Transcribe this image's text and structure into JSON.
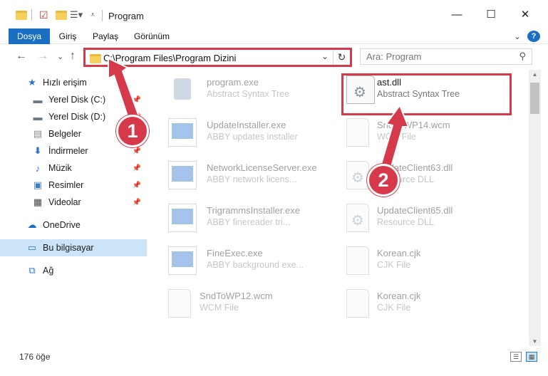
{
  "window": {
    "title": "Program",
    "minimize": "—",
    "maximize": "☐",
    "close": "✕"
  },
  "ribbon": {
    "tabs": [
      "Dosya",
      "Giriş",
      "Paylaş",
      "Görünüm"
    ],
    "expand": "⌄",
    "help": "?"
  },
  "nav": {
    "back": "←",
    "forward": "→",
    "recent": "⌄",
    "up": "↑",
    "address": "C:\\Program Files\\Program Dizini",
    "dropdown": "⌄",
    "refresh": "↻",
    "search_placeholder": "Ara: Program"
  },
  "sidebar": {
    "items": [
      {
        "label": "Hızlı erişim",
        "icon": "star-icon",
        "pinned": false
      },
      {
        "label": "Yerel Disk (C:)",
        "icon": "drive-icon",
        "pinned": true
      },
      {
        "label": "Yerel Disk (D:)",
        "icon": "drive-icon",
        "pinned": true
      },
      {
        "label": "Belgeler",
        "icon": "document-icon",
        "pinned": true
      },
      {
        "label": "İndirmeler",
        "icon": "download-icon",
        "pinned": true
      },
      {
        "label": "Müzik",
        "icon": "music-icon",
        "pinned": true
      },
      {
        "label": "Resimler",
        "icon": "picture-icon",
        "pinned": true
      },
      {
        "label": "Videolar",
        "icon": "video-icon",
        "pinned": true
      },
      {
        "label": "OneDrive",
        "icon": "cloud-icon",
        "pinned": false
      },
      {
        "label": "Bu bilgisayar",
        "icon": "computer-icon",
        "pinned": false
      },
      {
        "label": "Ağ",
        "icon": "network-icon",
        "pinned": false
      }
    ]
  },
  "files": {
    "left": [
      {
        "name": "program.exe",
        "desc": "Abstract Syntax Tree",
        "icon": "installer-icon"
      },
      {
        "name": "UpdateInstaller.exe",
        "desc": "ABBY updates installer",
        "icon": "app-icon"
      },
      {
        "name": "NetworkLicenseServer.exe",
        "desc": "ABBY network licens...",
        "icon": "app-icon"
      },
      {
        "name": "TrigrammsInstaller.exe",
        "desc": "ABBY finereader tri...",
        "icon": "app-icon"
      },
      {
        "name": "FineExec.exe",
        "desc": "ABBY background exe...",
        "icon": "app-icon"
      },
      {
        "name": "SndToWP12.wcm",
        "desc": "WCM File",
        "icon": "file-icon"
      }
    ],
    "right": [
      {
        "name": "ast.dll",
        "desc": "Abstract Syntax Tree",
        "icon": "dll-gear-icon"
      },
      {
        "name": "SndToWP14.wcm",
        "desc": "WCM File",
        "icon": "file-icon"
      },
      {
        "name": "UpdateClient63.dll",
        "desc": "Resource DLL",
        "icon": "dll-gear-icon"
      },
      {
        "name": "UpdateClient65.dll",
        "desc": "Resource DLL",
        "icon": "dll-gear-icon"
      },
      {
        "name": "Korean.cjk",
        "desc": "CJK File",
        "icon": "file-icon"
      },
      {
        "name": "Korean.cjk",
        "desc": "CJK File",
        "icon": "file-icon"
      }
    ]
  },
  "status": {
    "count": "176 öğe"
  },
  "annotations": {
    "badge1": "1",
    "badge2": "2",
    "color": "#d63a4a"
  }
}
